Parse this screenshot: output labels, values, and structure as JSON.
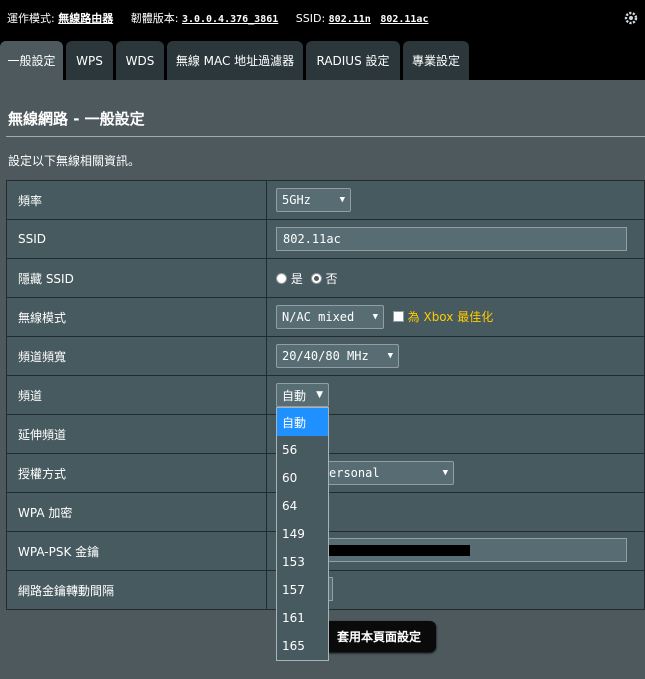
{
  "topbar": {
    "mode_label": "運作模式:",
    "mode_value": "無線路由器",
    "firmware_label": "韌體版本:",
    "firmware_value": "3.0.0.4.376_3861",
    "ssid_label": "SSID:",
    "ssid_values": [
      "802.11n",
      "802.11ac"
    ],
    "icon": "gear-icon"
  },
  "tabs": [
    "一般設定",
    "WPS",
    "WDS",
    "無線 MAC 地址過濾器",
    "RADIUS 設定",
    "專業設定"
  ],
  "active_tab": "一般設定",
  "page_title": "無線網路 - 一般設定",
  "description": "設定以下無線相關資訊。",
  "rows": {
    "band": {
      "label": "頻率",
      "value": "5GHz"
    },
    "ssid": {
      "label": "SSID",
      "value": "802.11ac"
    },
    "hide_ssid": {
      "label": "隱藏 SSID",
      "yes": "是",
      "no": "否",
      "selected": "否"
    },
    "wireless_mode": {
      "label": "無線模式",
      "value": "N/AC mixed",
      "xbox_label": "為 Xbox 最佳化"
    },
    "bandwidth": {
      "label": "頻道頻寬",
      "value": "20/40/80 MHz"
    },
    "channel": {
      "label": "頻道",
      "value": "自動"
    },
    "ext_channel": {
      "label": "延伸頻道"
    },
    "auth_method": {
      "label": "授權方式",
      "value": "WPA2-Personal",
      "visible_value": "ersonal"
    },
    "wpa_encryption": {
      "label": "WPA 加密"
    },
    "wpa_psk": {
      "label": "WPA-PSK 金鑰"
    },
    "key_rotation": {
      "label": "網路金鑰轉動間隔"
    }
  },
  "channel_options": [
    "自動",
    "56",
    "60",
    "64",
    "149",
    "153",
    "157",
    "161",
    "165"
  ],
  "channel_selected": "自動",
  "apply_button": "套用本頁面設定",
  "colors": {
    "background": "#4d595d",
    "topbar": "#000000",
    "xbox_link": "#ffcc00",
    "dropdown_highlight": "#1e90ff"
  }
}
